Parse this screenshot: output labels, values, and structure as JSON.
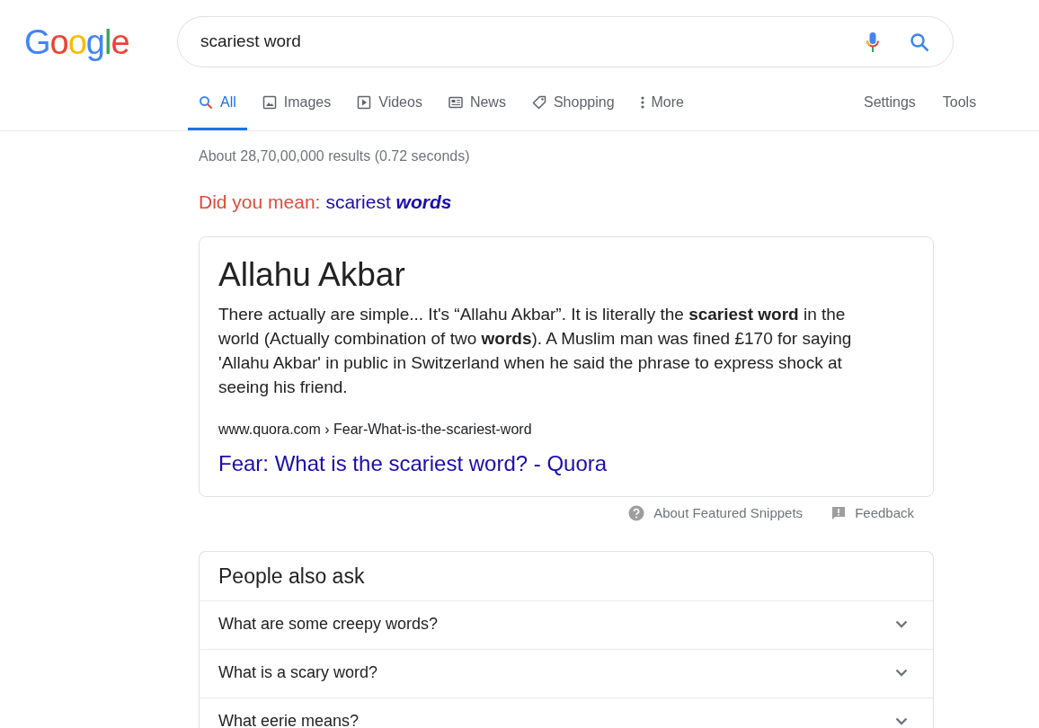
{
  "logo": "Google",
  "search": {
    "value": "scariest word"
  },
  "tabs": [
    {
      "label": "All",
      "kind": "search",
      "selected": true
    },
    {
      "label": "Images",
      "kind": "image",
      "selected": false
    },
    {
      "label": "Videos",
      "kind": "video",
      "selected": false
    },
    {
      "label": "News",
      "kind": "news",
      "selected": false
    },
    {
      "label": "Shopping",
      "kind": "tag",
      "selected": false
    },
    {
      "label": "More",
      "kind": "more",
      "selected": false
    }
  ],
  "tools": [
    "Settings",
    "Tools"
  ],
  "result_stats": "About 28,70,00,000 results (0.72 seconds)",
  "spelling": {
    "prompt": "Did you mean:",
    "suggestion": "scariest **words**"
  },
  "featured_snippet": {
    "title": "Allahu Akbar",
    "text": "There actually are simple... It's “Allahu Akbar”. It is literally the **scariest word** in the world (Actually combination of two **words**). A Muslim man was fined £170 for saying 'Allahu Akbar' in public in Switzerland when he said the phrase to express shock at seeing his friend.",
    "breadcrumb": "www.quora.com › Fear-What-is-the-scariest-word",
    "link": "Fear: What is the scariest word? - Quora"
  },
  "snippet_footer": [
    "About Featured Snippets",
    "Feedback"
  ],
  "people_also_ask": {
    "title": "People also ask",
    "questions": [
      {
        "text": "What are some creepy words?",
        "expanded": false
      },
      {
        "text": "What is a scary word?",
        "expanded": false
      },
      {
        "text": "What eerie means?",
        "expanded": false
      }
    ]
  }
}
